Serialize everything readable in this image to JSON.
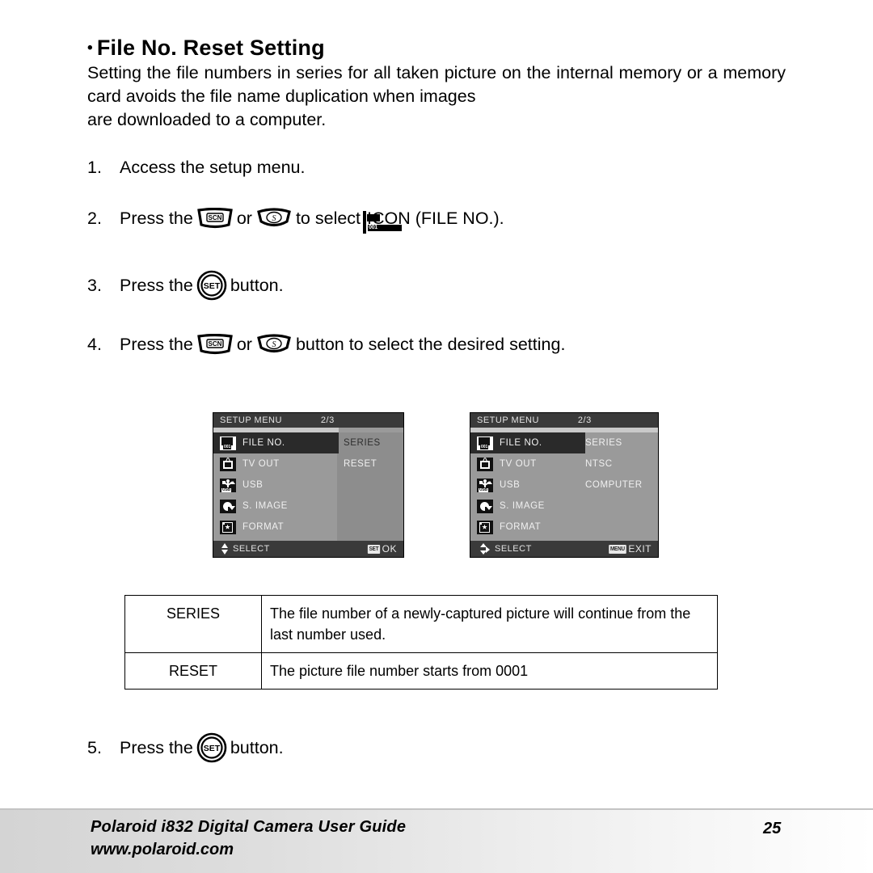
{
  "heading": {
    "bullet": "•",
    "text": "File No. Reset Setting"
  },
  "intro": {
    "line1": "Setting the file numbers in series for all taken picture on the internal",
    "line2": "memory or a memory card avoids the file name duplication when images",
    "line3": "are downloaded to a computer."
  },
  "steps": {
    "s1": {
      "num": "1.",
      "text": "Access the setup menu."
    },
    "s2": {
      "num": "2.",
      "before": "Press the",
      "or": "or",
      "mid": "to select",
      "after": "ICON (FILE NO.).",
      "icon_scn": "scn-button-icon",
      "icon_self": "self-timer-button-icon",
      "icon_file": "file-no-icon",
      "file_icon_number": "001"
    },
    "s3": {
      "num": "3.",
      "before": "Press the",
      "after": "button.",
      "icon_set": "set-button-icon"
    },
    "s4": {
      "num": "4.",
      "before": "Press the",
      "or": "or",
      "after": "button to select the desired setting.",
      "icon_scn": "scn-button-icon",
      "icon_self": "self-timer-button-icon"
    },
    "s5": {
      "num": "5.",
      "before": "Press the",
      "after": "button.",
      "icon_set": "set-button-icon"
    }
  },
  "lcd1": {
    "header_title": "SETUP MENU",
    "header_page": "2/3",
    "rows": [
      {
        "label": "FILE NO.",
        "icon": "file-no-icon",
        "selected": true
      },
      {
        "label": "TV OUT",
        "icon": "tv-out-icon",
        "selected": false
      },
      {
        "label": "USB",
        "icon": "usb-icon",
        "selected": false
      },
      {
        "label": "S.  IMAGE",
        "icon": "startup-image-icon",
        "selected": false
      },
      {
        "label": "FORMAT",
        "icon": "format-icon",
        "selected": false
      }
    ],
    "values": [
      {
        "text": "SERIES",
        "style": "dark"
      },
      {
        "text": "RESET",
        "style": "light"
      }
    ],
    "footer_left_label": "SELECT",
    "footer_left_icon": "up-down-arrows-icon",
    "footer_right_key": "SET",
    "footer_right_label": "OK"
  },
  "lcd2": {
    "header_title": "SETUP MENU",
    "header_page": "2/3",
    "rows": [
      {
        "label": "FILE NO.",
        "icon": "file-no-icon",
        "selected": true
      },
      {
        "label": "TV OUT",
        "icon": "tv-out-icon",
        "selected": false
      },
      {
        "label": "USB",
        "icon": "usb-icon",
        "selected": false
      },
      {
        "label": "S. IMAGE",
        "icon": "startup-image-icon",
        "selected": false
      },
      {
        "label": "FORMAT",
        "icon": "format-icon",
        "selected": false
      }
    ],
    "values": [
      {
        "text": "SERIES",
        "style": "light"
      },
      {
        "text": "NTSC",
        "style": "light"
      },
      {
        "text": "COMPUTER",
        "style": "light"
      }
    ],
    "footer_left_label": "SELECT",
    "footer_left_icon": "four-way-arrows-icon",
    "footer_right_key": "MENU",
    "footer_right_label": "EXIT"
  },
  "desc_table": {
    "rows": [
      {
        "key": "SERIES",
        "desc_line1": "The file number of a newly-captured picture will continue from",
        "desc_line2": "the last number used."
      },
      {
        "key": "RESET",
        "desc_line1": "The picture file number starts from 0001",
        "desc_line2": ""
      }
    ]
  },
  "footer": {
    "title": "Polaroid i832 Digital Camera User Guide",
    "url": "www.polaroid.com",
    "page": "25"
  }
}
